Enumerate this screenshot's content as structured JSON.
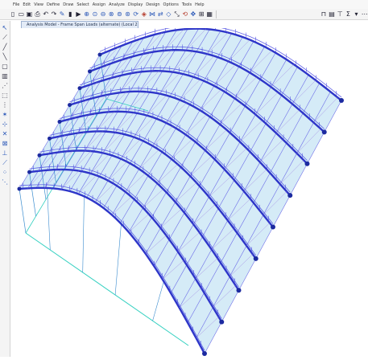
{
  "menu": [
    "File",
    "Edit",
    "View",
    "Define",
    "Draw",
    "Select",
    "Assign",
    "Analyze",
    "Display",
    "Design",
    "Options",
    "Tools",
    "Help"
  ],
  "view_tab": {
    "title": "Analysis Model - Frame Span Loads (alternate) (Local 2Ds)"
  },
  "toolbar": {
    "left_icons": [
      "new-icon",
      "open-icon",
      "save-icon",
      "print-icon",
      "undo-icon",
      "redo-icon",
      "edit-icon",
      "lock-icon",
      "run-icon",
      "zoom-extents-icon",
      "zoom-in-icon",
      "zoom-out-icon",
      "zoom-window-icon",
      "pan-icon",
      "zoom-previous-icon",
      "rotate-icon",
      "3d-view-icon",
      "plan-view-icon",
      "elevation-view-icon",
      "perspective-icon",
      "shrink-icon",
      "refresh-icon",
      "select-all-icon",
      "grid-icon",
      "display-options-icon"
    ],
    "right_icons": [
      "frame-icon",
      "table-icon",
      "section-icon",
      "sum-icon",
      "filter-icon",
      "more-icon"
    ]
  },
  "sidebar_icons": [
    "pointer-icon",
    "draw-frame-icon",
    "quick-frame-icon",
    "draw-brace-icon",
    "draw-area-icon",
    "draw-wall-icon",
    "draw-link-icon",
    "rubber-band-icon",
    "draw-section-icon",
    "snap-point-icon",
    "snap-end-icon",
    "snap-mid-icon",
    "snap-intersection-icon",
    "snap-perp-icon",
    "snap-line-icon",
    "snap-grid-icon",
    "snap-fine-icon"
  ],
  "model": {
    "colors": {
      "frame": "#2d35c8",
      "purlin": "#6e6ee8",
      "member": "#3a8ccf",
      "load": "#3f3fe0",
      "base": "#33d0c0",
      "deck": "#86c6e8"
    },
    "arch_count": 9
  }
}
